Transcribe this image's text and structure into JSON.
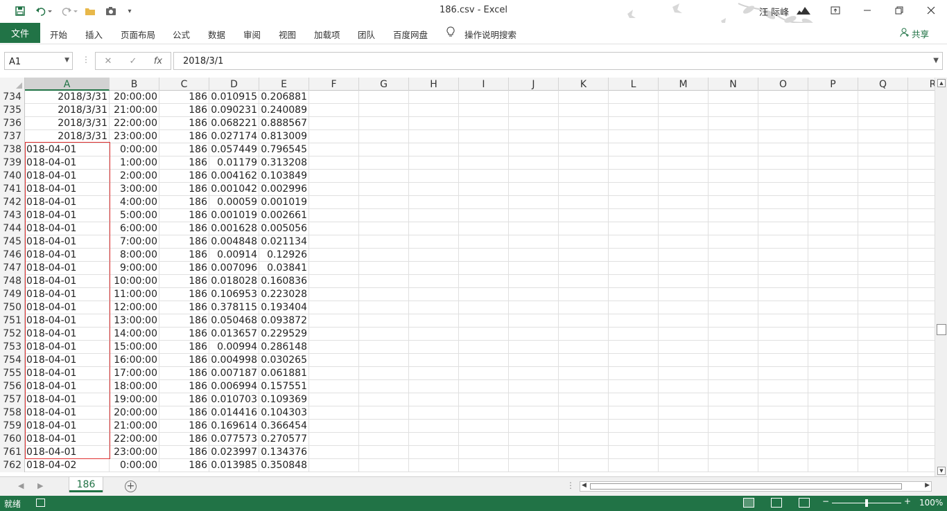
{
  "window": {
    "title": "186.csv  -  Excel",
    "user": "汪 际峰"
  },
  "ribbon": {
    "file": "文件",
    "tabs": [
      "开始",
      "插入",
      "页面布局",
      "公式",
      "数据",
      "审阅",
      "视图",
      "加载项",
      "团队",
      "百度网盘"
    ],
    "tell_me": "操作说明搜索",
    "share": "共享"
  },
  "formula_bar": {
    "name_box": "A1",
    "fx": "fx",
    "value": "2018/3/1"
  },
  "columns": [
    "A",
    "B",
    "C",
    "D",
    "E",
    "F",
    "G",
    "H",
    "I",
    "J",
    "K",
    "L",
    "M",
    "N",
    "O",
    "P",
    "Q",
    "R"
  ],
  "rows": [
    [
      "734",
      "2018/3/31",
      "20:00:00",
      "186",
      "0.010915",
      "0.206881"
    ],
    [
      "735",
      "2018/3/31",
      "21:00:00",
      "186",
      "0.090231",
      "0.240089"
    ],
    [
      "736",
      "2018/3/31",
      "22:00:00",
      "186",
      "0.068221",
      "0.888567"
    ],
    [
      "737",
      "2018/3/31",
      "23:00:00",
      "186",
      "0.027174",
      "0.813009"
    ],
    [
      "738",
      "018-04-01",
      "0:00:00",
      "186",
      "0.057449",
      "0.796545"
    ],
    [
      "739",
      "018-04-01",
      "1:00:00",
      "186",
      "0.01179",
      "0.313208"
    ],
    [
      "740",
      "018-04-01",
      "2:00:00",
      "186",
      "0.004162",
      "0.103849"
    ],
    [
      "741",
      "018-04-01",
      "3:00:00",
      "186",
      "0.001042",
      "0.002996"
    ],
    [
      "742",
      "018-04-01",
      "4:00:00",
      "186",
      "0.00059",
      "0.001019"
    ],
    [
      "743",
      "018-04-01",
      "5:00:00",
      "186",
      "0.001019",
      "0.002661"
    ],
    [
      "744",
      "018-04-01",
      "6:00:00",
      "186",
      "0.001628",
      "0.005056"
    ],
    [
      "745",
      "018-04-01",
      "7:00:00",
      "186",
      "0.004848",
      "0.021134"
    ],
    [
      "746",
      "018-04-01",
      "8:00:00",
      "186",
      "0.00914",
      "0.12926"
    ],
    [
      "747",
      "018-04-01",
      "9:00:00",
      "186",
      "0.007096",
      "0.03841"
    ],
    [
      "748",
      "018-04-01",
      "10:00:00",
      "186",
      "0.018028",
      "0.160836"
    ],
    [
      "749",
      "018-04-01",
      "11:00:00",
      "186",
      "0.106953",
      "0.223028"
    ],
    [
      "750",
      "018-04-01",
      "12:00:00",
      "186",
      "0.378115",
      "0.193404"
    ],
    [
      "751",
      "018-04-01",
      "13:00:00",
      "186",
      "0.050468",
      "0.093872"
    ],
    [
      "752",
      "018-04-01",
      "14:00:00",
      "186",
      "0.013657",
      "0.229529"
    ],
    [
      "753",
      "018-04-01",
      "15:00:00",
      "186",
      "0.00994",
      "0.286148"
    ],
    [
      "754",
      "018-04-01",
      "16:00:00",
      "186",
      "0.004998",
      "0.030265"
    ],
    [
      "755",
      "018-04-01",
      "17:00:00",
      "186",
      "0.007187",
      "0.061881"
    ],
    [
      "756",
      "018-04-01",
      "18:00:00",
      "186",
      "0.006994",
      "0.157551"
    ],
    [
      "757",
      "018-04-01",
      "19:00:00",
      "186",
      "0.010703",
      "0.109369"
    ],
    [
      "758",
      "018-04-01",
      "20:00:00",
      "186",
      "0.014416",
      "0.104303"
    ],
    [
      "759",
      "018-04-01",
      "21:00:00",
      "186",
      "0.169614",
      "0.366454"
    ],
    [
      "760",
      "018-04-01",
      "22:00:00",
      "186",
      "0.077573",
      "0.270577"
    ],
    [
      "761",
      "018-04-01",
      "23:00:00",
      "186",
      "0.023997",
      "0.134376"
    ],
    [
      "762",
      "018-04-02",
      "0:00:00",
      "186",
      "0.013985",
      "0.350848"
    ]
  ],
  "sheet_tab": "186",
  "status": {
    "ready": "就绪",
    "zoom": "100%"
  },
  "colors": {
    "accent": "#217346",
    "highlight_border": "#e03030"
  }
}
